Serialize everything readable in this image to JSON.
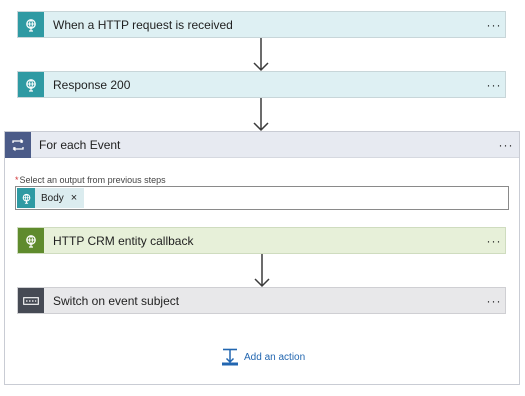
{
  "trigger": {
    "title": "When a HTTP request is received",
    "menu": "···"
  },
  "response": {
    "title": "Response 200",
    "menu": "···"
  },
  "foreach": {
    "title": "For each Event",
    "menu": "···",
    "field": {
      "required_mark": "*",
      "label": "Select an output from previous steps",
      "token": {
        "label": "Body",
        "remove": "×"
      }
    },
    "crm": {
      "title": "HTTP CRM entity callback",
      "menu": "···"
    },
    "switch": {
      "title": "Switch on event subject",
      "menu": "···"
    },
    "add_action": "Add an action"
  },
  "colors": {
    "http_teal": "#2f9aa3",
    "foreach_navy": "#4b5b88",
    "crm_green": "#5f8b2d",
    "switch_gray": "#464a54",
    "link_blue": "#2266b0"
  }
}
